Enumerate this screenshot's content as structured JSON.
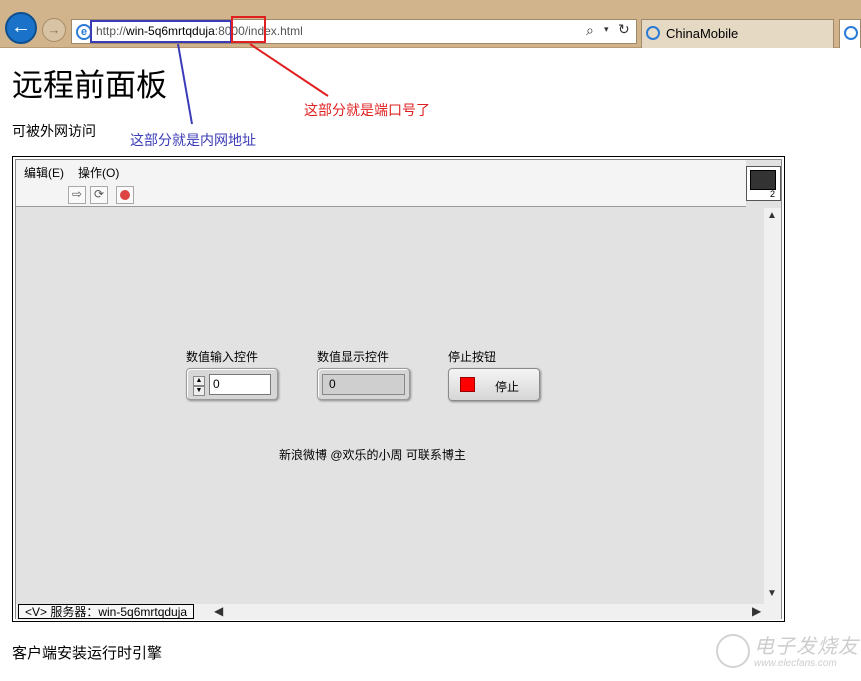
{
  "browser": {
    "url_prefix": "http://",
    "url_host": "win-5q6mrtqduja",
    "url_port": ":8000",
    "url_path": "/index.html",
    "tab_label": "ChinaMobile",
    "back_icon": "←",
    "forward_icon": "→",
    "search_icon": "⌕",
    "dropdown_icon": "▾",
    "refresh_icon": "↻"
  },
  "annotations": {
    "host_note": "这部分就是内网地址",
    "port_note": "这部分就是端口号了",
    "host_color": "#3b3bb8",
    "port_color": "#e02020"
  },
  "page": {
    "title": "远程前面板",
    "subtitle": "可被外网访问",
    "footer": "客户端安装运行时引擎"
  },
  "panel": {
    "menu": [
      "编辑(E)",
      "操作(O)"
    ],
    "toolbar": [
      "⇨",
      "⟳"
    ],
    "vi_icon_number": "2",
    "controls": {
      "numeric_input": {
        "label": "数值输入控件",
        "value": "0"
      },
      "numeric_output": {
        "label": "数值显示控件",
        "value": "0"
      },
      "stop_button": {
        "label": "停止按钮",
        "text": "停止",
        "led_color": "#ff0000"
      }
    },
    "credit": "新浪微博 @欢乐的小周 可联系博主",
    "server_label": "<V> 服务器：win-5q6mrtqduja",
    "scroll_up": "▲",
    "scroll_down": "▼",
    "scroll_left": "◀",
    "scroll_right": "▶",
    "spin_up": "▲",
    "spin_down": "▼"
  },
  "watermark": {
    "title": "电子发烧友",
    "url": "www.elecfans.com"
  }
}
